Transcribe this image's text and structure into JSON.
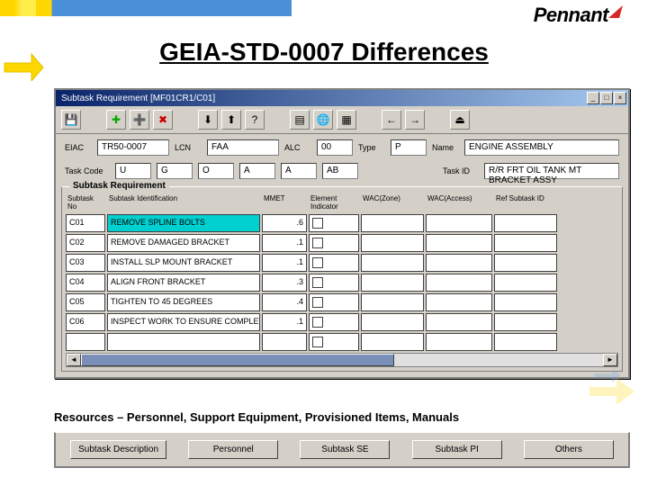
{
  "brand": "Pennant",
  "title": "GEIA-STD-0007 Differences",
  "window": {
    "title": "Subtask Requirement [MF01CR1/C01]"
  },
  "form": {
    "eiac_lbl": "EIAC",
    "eiac": "TR50-0007",
    "lcn_lbl": "LCN",
    "lcn": "FAA",
    "alc_lbl": "ALC",
    "alc": "00",
    "type_lbl": "Type",
    "type": "P",
    "name_lbl": "Name",
    "name": "ENGINE ASSEMBLY",
    "taskcode_lbl": "Task Code",
    "tc1": "U",
    "tc2": "G",
    "tc3": "O",
    "tc4": "A",
    "tc5": "A",
    "tc6": "AB",
    "taskid_lbl": "Task ID",
    "taskid": "R/R FRT OIL TANK MT BRACKET ASSY"
  },
  "group_title": "Subtask Requirement",
  "columns": {
    "c1": "Subtask No",
    "c2": "Subtask Identification",
    "c3": "MMET",
    "c4": "Element Indicator",
    "c5": "WAC(Zone)",
    "c6": "WAC(Access)",
    "c7": "Ref Subtask ID"
  },
  "rows": [
    {
      "no": "C01",
      "id": "REMOVE SPLINE BOLTS",
      "mmet": ".6",
      "sel": true
    },
    {
      "no": "C02",
      "id": "REMOVE DAMAGED BRACKET",
      "mmet": ".1"
    },
    {
      "no": "C03",
      "id": "INSTALL SLP MOUNT BRACKET",
      "mmet": ".1"
    },
    {
      "no": "C04",
      "id": "ALIGN FRONT BRACKET",
      "mmet": ".3"
    },
    {
      "no": "C05",
      "id": "TIGHTEN TO 45 DEGREES",
      "mmet": ".4"
    },
    {
      "no": "C06",
      "id": "INSPECT WORK TO ENSURE COMPLETION",
      "mmet": ".1"
    }
  ],
  "caption": "Resources – Personnel, Support Equipment, Provisioned Items, Manuals",
  "buttons": {
    "b1": "Subtask Description",
    "b2": "Personnel",
    "b3": "Subtask SE",
    "b4": "Subtask PI",
    "b5": "Others"
  }
}
